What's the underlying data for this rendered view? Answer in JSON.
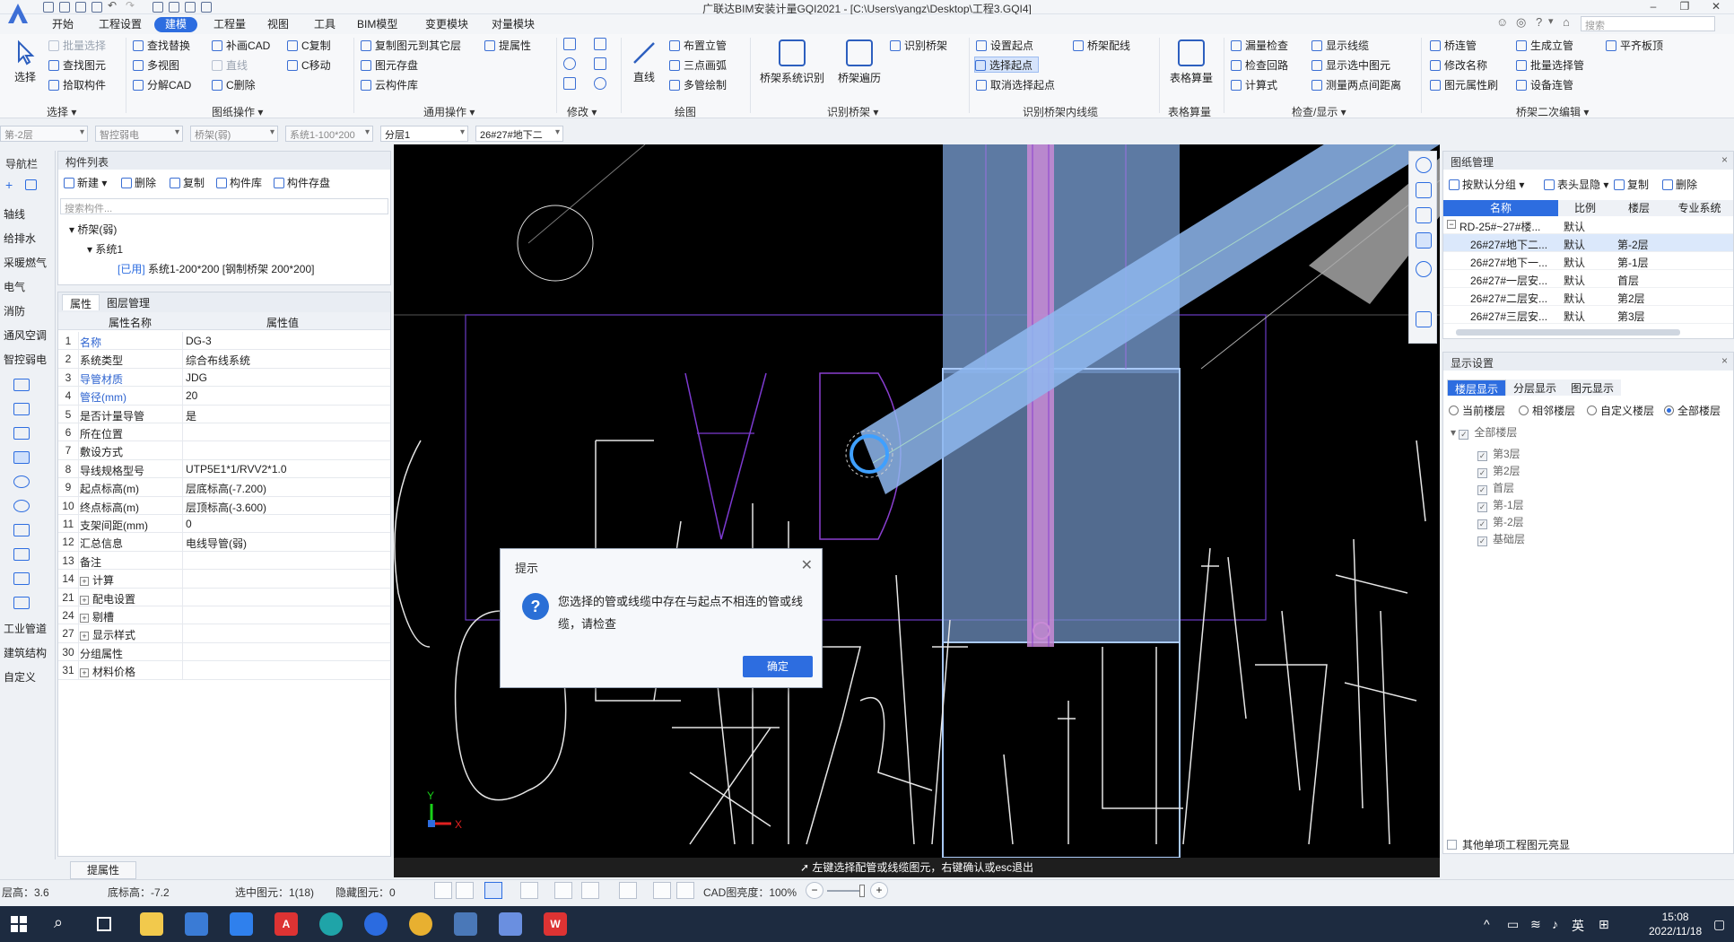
{
  "window": {
    "title": "广联达BIM安装计量GQI2021 - [C:\\Users\\yangz\\Desktop\\工程3.GQI4]",
    "search_placeholder": "搜索"
  },
  "menu": [
    "开始",
    "工程设置",
    "建模",
    "工程量",
    "视图",
    "工具",
    "BIM模型",
    "变更模块",
    "对量模块"
  ],
  "ribbon": {
    "select": {
      "label": "选择",
      "group": "选择 ▾",
      "items": [
        "批量选择",
        "查找图元",
        "拾取构件"
      ]
    },
    "drawing_ops": {
      "group": "图纸操作 ▾",
      "items": [
        "查找替换",
        "多视图",
        "分解CAD",
        "补画CAD",
        "直线",
        "C删除",
        "C复制",
        "C移动"
      ]
    },
    "general_ops": {
      "group": "通用操作 ▾",
      "items": [
        "复制图元到其它层",
        "图元存盘",
        "云构件库",
        "提属性"
      ]
    },
    "modify": {
      "group": "修改 ▾"
    },
    "draw": {
      "group": "绘图",
      "big": "直线",
      "items": [
        "布置立管",
        "三点画弧",
        "多管绘制"
      ]
    },
    "recognize_tray": {
      "group": "识别桥架 ▾",
      "big1": "桥架系统识别",
      "big2": "桥架遍历",
      "item": "识别桥架"
    },
    "tray_wiring": {
      "group": "识别桥架内线缆",
      "items": [
        "设置起点",
        "选择起点",
        "取消选择起点",
        "桥架配线"
      ]
    },
    "table_calc": {
      "group": "表格算量",
      "big": "表格算量"
    },
    "check": {
      "group": "检查/显示 ▾",
      "items": [
        "漏量检查",
        "检查回路",
        "计算式",
        "显示线缆",
        "显示选中图元",
        "测量两点间距离"
      ]
    },
    "tray_edit": {
      "group": "桥架二次编辑 ▾",
      "items": [
        "桥连管",
        "修改名称",
        "图元属性刷",
        "生成立管",
        "批量选择管",
        "设备连管",
        "平齐板顶"
      ]
    }
  },
  "filters": [
    "第-2层",
    "智控弱电",
    "桥架(弱)",
    "系统1-100*200",
    "分层1",
    "26#27#地下二"
  ],
  "navbar": {
    "title": "导航栏",
    "items": [
      "轴线",
      "给排水",
      "采暖燃气",
      "电气",
      "消防",
      "通风空调",
      "智控弱电",
      "工业管道",
      "建筑结构",
      "自定义"
    ]
  },
  "component_list": {
    "title": "构件列表",
    "toolbar": [
      "新建",
      "删除",
      "复制",
      "构件库",
      "构件存盘"
    ],
    "search_placeholder": "搜索构件...",
    "tree": {
      "root": "桥架(弱)",
      "child": "系统1",
      "used_tag": "[已用]",
      "leaf": "系统1-200*200 [钢制桥架 200*200]"
    }
  },
  "properties": {
    "tabs": [
      "属性",
      "图层管理"
    ],
    "headers": [
      "属性名称",
      "属性值"
    ],
    "rows": [
      {
        "idx": "1",
        "name": "名称",
        "value": "DG-3",
        "blue": true
      },
      {
        "idx": "2",
        "name": "系统类型",
        "value": "综合布线系统"
      },
      {
        "idx": "3",
        "name": "导管材质",
        "value": "JDG",
        "blue": true
      },
      {
        "idx": "4",
        "name": "管径(mm)",
        "value": "20",
        "blue": true
      },
      {
        "idx": "5",
        "name": "是否计量导管",
        "value": "是"
      },
      {
        "idx": "6",
        "name": "所在位置",
        "value": ""
      },
      {
        "idx": "7",
        "name": "敷设方式",
        "value": ""
      },
      {
        "idx": "8",
        "name": "导线规格型号",
        "value": "UTP5E1*1/RVV2*1.0"
      },
      {
        "idx": "9",
        "name": "起点标高(m)",
        "value": "层底标高(-7.200)"
      },
      {
        "idx": "10",
        "name": "终点标高(m)",
        "value": "层顶标高(-3.600)"
      },
      {
        "idx": "11",
        "name": "支架间距(mm)",
        "value": "0"
      },
      {
        "idx": "12",
        "name": "汇总信息",
        "value": "电线导管(弱)"
      },
      {
        "idx": "13",
        "name": "备注",
        "value": ""
      },
      {
        "idx": "14",
        "name": "计算",
        "value": "",
        "exp": true
      },
      {
        "idx": "21",
        "name": "配电设置",
        "value": "",
        "exp": true
      },
      {
        "idx": "24",
        "name": "剔槽",
        "value": "",
        "exp": true
      },
      {
        "idx": "27",
        "name": "显示样式",
        "value": "",
        "exp": true
      },
      {
        "idx": "30",
        "name": "分组属性",
        "value": ""
      },
      {
        "idx": "31",
        "name": "材料价格",
        "value": "",
        "exp": true
      }
    ],
    "bottom_button": "提属性"
  },
  "canvas": {
    "status_hint": "左键选择配管或线缆图元，右键确认或esc退出",
    "axis_x": "X",
    "axis_y": "Y"
  },
  "drawing_manager": {
    "title": "图纸管理",
    "toolbar": [
      "按默认分组",
      "表头显隐",
      "复制",
      "删除"
    ],
    "columns": [
      "名称",
      "比例",
      "楼层",
      "专业系统"
    ],
    "rows": [
      {
        "name": "RD-25#~27#楼...",
        "scale": "默认",
        "floor": "",
        "group": true
      },
      {
        "name": "26#27#地下二...",
        "scale": "默认",
        "floor": "第-2层",
        "selected": true
      },
      {
        "name": "26#27#地下一...",
        "scale": "默认",
        "floor": "第-1层"
      },
      {
        "name": "26#27#一层安...",
        "scale": "默认",
        "floor": "首层"
      },
      {
        "name": "26#27#二层安...",
        "scale": "默认",
        "floor": "第2层"
      },
      {
        "name": "26#27#三层安...",
        "scale": "默认",
        "floor": "第3层"
      }
    ]
  },
  "display_settings": {
    "title": "显示设置",
    "tabs": [
      "楼层显示",
      "分层显示",
      "图元显示"
    ],
    "radios": [
      "当前楼层",
      "相邻楼层",
      "自定义楼层",
      "全部楼层"
    ],
    "selected_radio": "全部楼层",
    "tree_root": "全部楼层",
    "floors": [
      "第3层",
      "第2层",
      "首层",
      "第-1层",
      "第-2层",
      "基础层"
    ],
    "bottom_check": "其他单项工程图元亮显"
  },
  "dialog": {
    "title": "提示",
    "message": "您选择的管或线缆中存在与起点不相连的管或线缆，请检查",
    "ok": "确定"
  },
  "statusbar": {
    "floor_height": "层高：3.6",
    "base_elev": "底标高：-7.2",
    "selected": "选中图元：1(18)",
    "hidden": "隐藏图元：0",
    "cad_brightness": "CAD图亮度：100%"
  },
  "taskbar": {
    "ime": "英",
    "time": "15:08",
    "date": "2022/11/18"
  },
  "colors": {
    "accent": "#2d6de0",
    "tray_fill": "#8fb8f0",
    "purple": "#8a3fd0",
    "pink": "#c98bd6"
  }
}
